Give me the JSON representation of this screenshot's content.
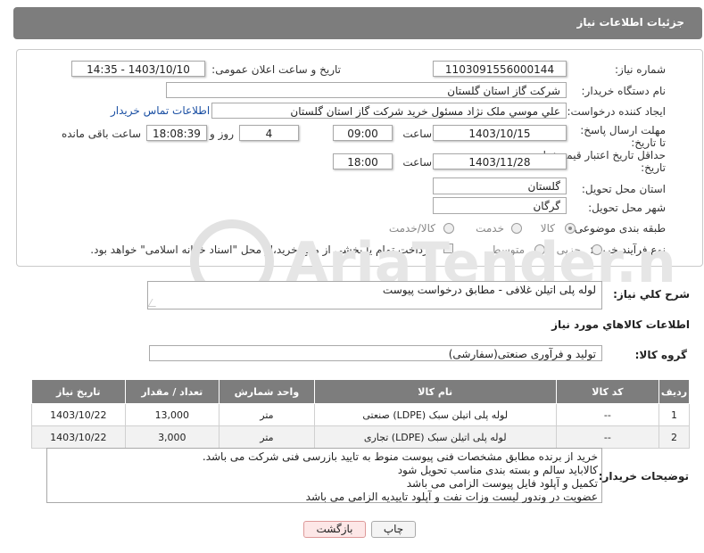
{
  "header": {
    "title": "جزئیات اطلاعات نیاز"
  },
  "labels": {
    "need_number": "شماره نیاز:",
    "announce_datetime": "تاریخ و ساعت اعلان عمومی:",
    "buyer_org": "نام دستگاه خریدار:",
    "requester": "ایجاد کننده درخواست:",
    "reply_deadline": "مهلت ارسال پاسخ: تا تاریخ:",
    "time": "ساعت",
    "day_and": "روز و",
    "remaining": "ساعت باقی مانده",
    "price_validity": "حداقل تاریخ اعتبار قیمت: تا تاریخ:",
    "time2": "ساعت",
    "delivery_province": "استان محل تحویل:",
    "delivery_city": "شهر محل تحویل:",
    "category": "طبقه بندی موضوعی:",
    "purchase_type": "نوع فرآیند خرید :",
    "description": "شرح کلي نياز:",
    "goods_info": "اطلاعات کالاهاي مورد نياز",
    "goods_group": "گروه کالا:",
    "buyer_notes": "توضیحات خریدار:"
  },
  "fields": {
    "need_number": "1103091556000144",
    "announce_datetime": "1403/10/10 - 14:35",
    "buyer_org": "شرکت گاز استان گلستان",
    "requester": "علي موسي ملک نژاد مسئول خريد شرکت گاز استان گلستان",
    "buyer_contact_link": "اطلاعات تماس خریدار",
    "reply_date": "1403/10/15",
    "reply_time": "09:00",
    "reply_days": "4",
    "remaining_time": "18:08:39",
    "validity_date": "1403/11/28",
    "validity_time": "18:00",
    "province": "گلستان",
    "city": "گرگان",
    "description": "لوله پلی اتیلن غلافی - مطابق درخواست پیوست",
    "goods_group": "تولید و فرآوری صنعتی(سفارشی)"
  },
  "category_options": [
    {
      "label": "کالا",
      "selected": true
    },
    {
      "label": "خدمت",
      "selected": false
    },
    {
      "label": "کالا/خدمت",
      "selected": false
    }
  ],
  "purchase_options": [
    {
      "label": "جزیی",
      "selected": false
    },
    {
      "label": "متوسط",
      "selected": false
    }
  ],
  "payment_note": "پرداخت تمام یا بخشی از مبلغ خرید،از محل \"اسناد خزانه اسلامی\" خواهد بود.",
  "table": {
    "headers": [
      "ردیف",
      "کد کالا",
      "نام کالا",
      "واحد شمارش",
      "تعداد / مقدار",
      "تاریخ نیاز"
    ],
    "rows": [
      [
        "1",
        "--",
        "لوله پلی اتیلن سبک (LDPE) صنعتی",
        "متر",
        "13,000",
        "1403/10/22"
      ],
      [
        "2",
        "--",
        "لوله پلی اتیلن سبک (LDPE) تجاری",
        "متر",
        "3,000",
        "1403/10/22"
      ]
    ]
  },
  "notes_lines": [
    "خرید از برنده مطابق مشخصات فنی پیوست منوط به تایید بازرسی فنی شرکت می باشد.",
    "کالاباید سالم و بسته بندی مناسب تحویل شود",
    "تکمیل و آپلود فایل پیوست الزامی می باشد",
    "عضویت در وندور لیست وزات نفت و  آپلود تاییدیه الزامی می باشد"
  ],
  "buttons": {
    "print": "چاپ",
    "back": "بازگشت"
  },
  "watermark": {
    "text": "AriaTender.net"
  },
  "colors": {
    "header_bg": "#7d7d7d",
    "link": "#1a4fa3",
    "back_btn_bg": "#fde7e7"
  }
}
